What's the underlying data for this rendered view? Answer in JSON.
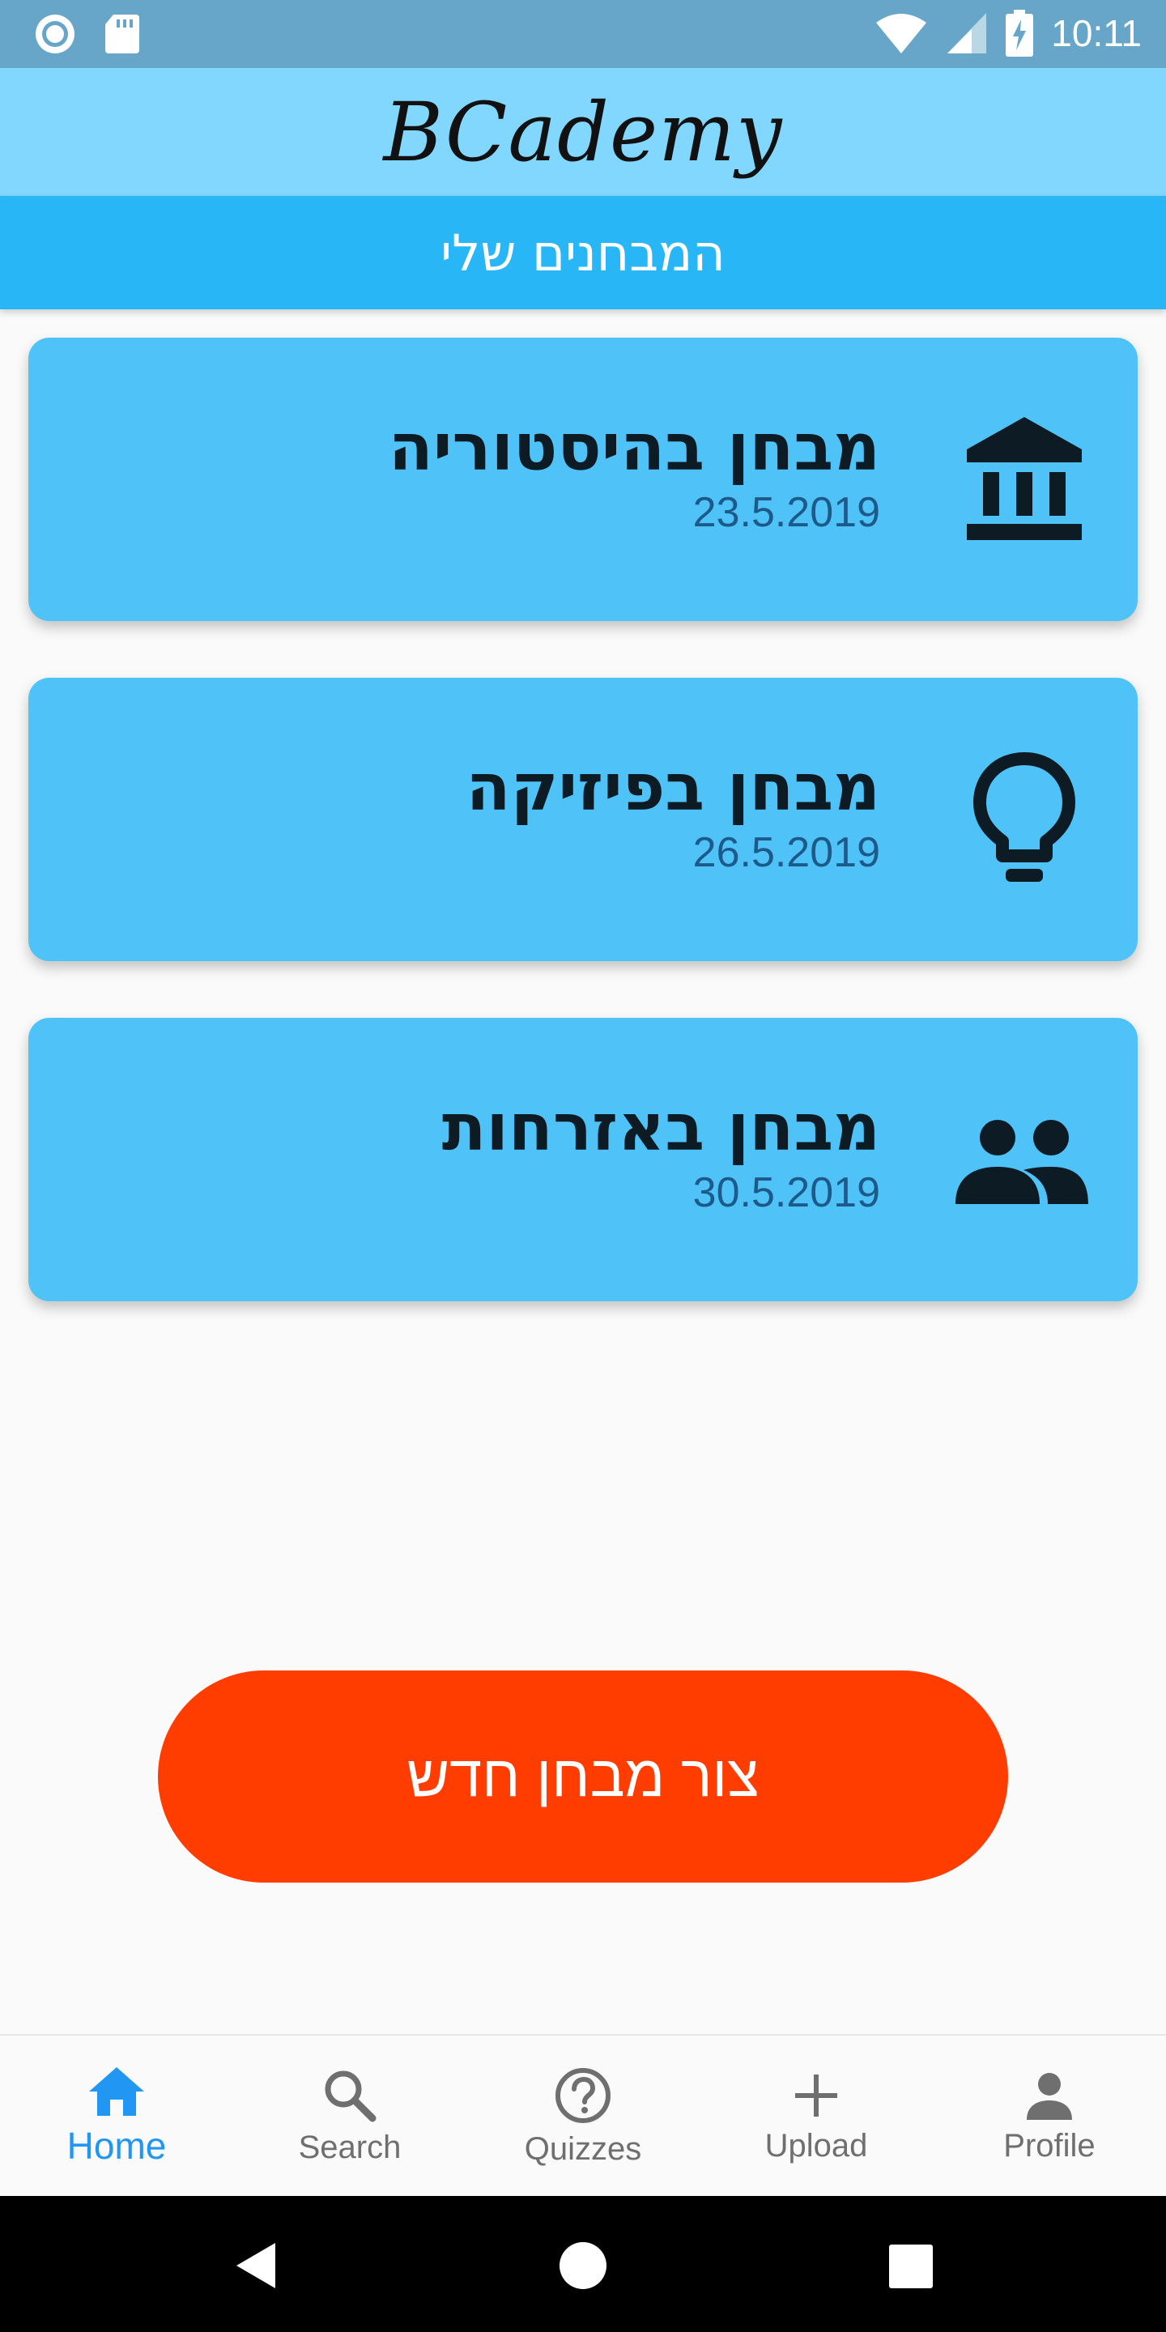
{
  "status_bar": {
    "time": "10:11",
    "icons": [
      "circle-indicator-icon",
      "sd-card-icon",
      "wifi-icon",
      "signal-icon",
      "battery-charging-icon"
    ]
  },
  "app_bar": {
    "brand": "BCademy"
  },
  "subheader": {
    "title": "המבחנים שלי"
  },
  "quizzes": [
    {
      "title": "מבחן בהיסטוריה",
      "date": "23.5.2019",
      "icon": "museum-icon"
    },
    {
      "title": "מבחן בפיזיקה",
      "date": "26.5.2019",
      "icon": "lightbulb-icon"
    },
    {
      "title": "מבחן באזרחות",
      "date": "30.5.2019",
      "icon": "people-icon"
    }
  ],
  "create_button": {
    "label": "צור מבחן חדש"
  },
  "bottom_nav": {
    "items": [
      {
        "label": "Home",
        "icon": "home-icon",
        "active": true
      },
      {
        "label": "Search",
        "icon": "search-icon",
        "active": false
      },
      {
        "label": "Quizzes",
        "icon": "help-circle-icon",
        "active": false
      },
      {
        "label": "Upload",
        "icon": "plus-icon",
        "active": false
      },
      {
        "label": "Profile",
        "icon": "person-icon",
        "active": false
      }
    ]
  },
  "colors": {
    "status_bar": "#67a6c8",
    "app_bar": "#82d7fe",
    "subheader": "#29b6f6",
    "card": "#4fc3f7",
    "create_button": "#ff3d00",
    "nav_active": "#2196f3",
    "nav_inactive": "#6f6f6f"
  }
}
